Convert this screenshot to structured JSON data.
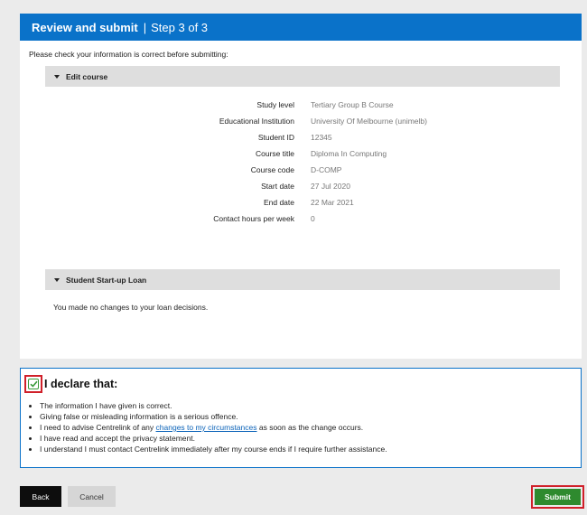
{
  "header": {
    "title": "Review and submit",
    "separator": "|",
    "step": "Step 3 of 3",
    "background_color": "#0a72c9"
  },
  "intro_text": "Please check your information is correct before submitting:",
  "edit_course": {
    "heading": "Edit course",
    "icon": "caret-down-icon",
    "rows": [
      {
        "label": "Study level",
        "value": "Tertiary Group B Course"
      },
      {
        "label": "Educational Institution",
        "value": "University Of Melbourne (unimelb)"
      },
      {
        "label": "Student ID",
        "value": "12345"
      },
      {
        "label": "Course title",
        "value": "Diploma In Computing"
      },
      {
        "label": "Course code",
        "value": "D-COMP"
      },
      {
        "label": "Start date",
        "value": "27 Jul 2020"
      },
      {
        "label": "End date",
        "value": "22 Mar 2021"
      },
      {
        "label": "Contact hours per week",
        "value": "0"
      }
    ]
  },
  "loan": {
    "heading": "Student Start-up Loan",
    "icon": "caret-down-icon",
    "note": "You made no changes to your loan decisions."
  },
  "declaration": {
    "checked": true,
    "checkbox_icon": "checkmark-icon",
    "title": "I declare that:",
    "items": [
      {
        "text": "The information I have given is correct."
      },
      {
        "text": "Giving false or misleading information is a serious offence."
      },
      {
        "before": "I need to advise Centrelink of any ",
        "link": "changes to my circumstances",
        "after": " as soon as the change occurs."
      },
      {
        "text": "I have read and accept the privacy statement."
      },
      {
        "text": "I understand I must contact Centrelink immediately after my course ends if I require further assistance."
      }
    ]
  },
  "buttons": {
    "back": "Back",
    "cancel": "Cancel",
    "submit": "Submit",
    "submit_color": "#2e8a2e",
    "highlight_color": "#d0202a"
  }
}
